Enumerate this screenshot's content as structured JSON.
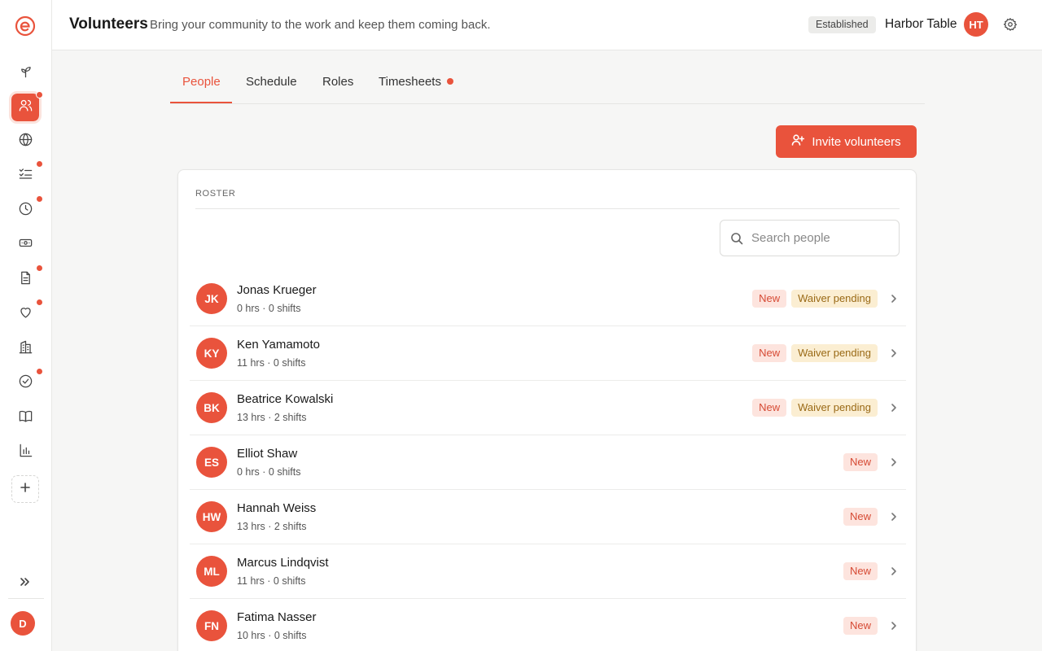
{
  "header": {
    "title": "Volunteers",
    "subtitle": "Bring your community to the work and keep them coming back.",
    "status_badge": "Established",
    "org_name": "Harbor Table",
    "org_initials": "HT"
  },
  "sidebar": {
    "user_initial": "D",
    "items": [
      {
        "icon": "sprout-icon",
        "badge": false
      },
      {
        "icon": "users-icon",
        "badge": true,
        "active": true
      },
      {
        "icon": "globe-icon",
        "badge": false
      },
      {
        "icon": "checklist-icon",
        "badge": true
      },
      {
        "icon": "clock-icon",
        "badge": true
      },
      {
        "icon": "banknote-icon",
        "badge": false
      },
      {
        "icon": "document-icon",
        "badge": true
      },
      {
        "icon": "heart-icon",
        "badge": true
      },
      {
        "icon": "building-icon",
        "badge": false
      },
      {
        "icon": "check-circle-icon",
        "badge": true
      },
      {
        "icon": "book-icon",
        "badge": false
      },
      {
        "icon": "bar-chart-icon",
        "badge": false
      }
    ]
  },
  "tabs": [
    {
      "label": "People",
      "active": true
    },
    {
      "label": "Schedule",
      "active": false
    },
    {
      "label": "Roles",
      "active": false
    },
    {
      "label": "Timesheets",
      "active": false,
      "notification": true
    }
  ],
  "invite_button": {
    "label": "Invite volunteers"
  },
  "roster": {
    "label": "ROSTER",
    "search_placeholder": "Search people",
    "people": [
      {
        "initials": "JK",
        "name": "Jonas Krueger",
        "meta": "0 hrs · 0 shifts",
        "badges": [
          "New",
          "Waiver pending"
        ]
      },
      {
        "initials": "KY",
        "name": "Ken Yamamoto",
        "meta": "11 hrs · 0 shifts",
        "badges": [
          "New",
          "Waiver pending"
        ]
      },
      {
        "initials": "BK",
        "name": "Beatrice Kowalski",
        "meta": "13 hrs · 2 shifts",
        "badges": [
          "New",
          "Waiver pending"
        ]
      },
      {
        "initials": "ES",
        "name": "Elliot Shaw",
        "meta": "0 hrs · 0 shifts",
        "badges": [
          "New"
        ]
      },
      {
        "initials": "HW",
        "name": "Hannah Weiss",
        "meta": "13 hrs · 2 shifts",
        "badges": [
          "New"
        ]
      },
      {
        "initials": "ML",
        "name": "Marcus Lindqvist",
        "meta": "11 hrs · 0 shifts",
        "badges": [
          "New"
        ]
      },
      {
        "initials": "FN",
        "name": "Fatima Nasser",
        "meta": "10 hrs · 0 shifts",
        "badges": [
          "New"
        ]
      }
    ]
  },
  "colors": {
    "accent": "#e9533c",
    "badge_new_bg": "#fde4de",
    "badge_waiver_bg": "#fbeed2"
  }
}
